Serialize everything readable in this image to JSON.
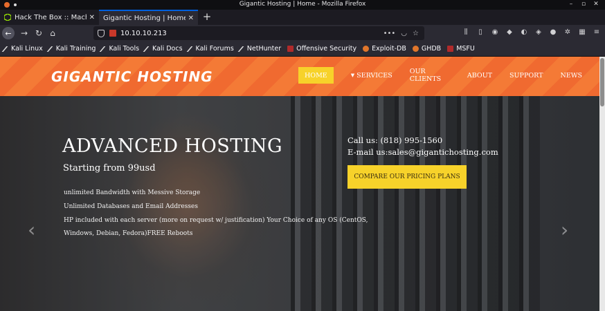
{
  "window": {
    "title": "Gigantic Hosting | Home - Mozilla Firefox"
  },
  "tabs": [
    {
      "label": "Hack The Box :: Machines",
      "active": false
    },
    {
      "label": "Gigantic Hosting | Home",
      "active": true
    }
  ],
  "nav": {
    "url": "10.10.10.213"
  },
  "bookmarks": [
    {
      "label": "Kali Linux",
      "icon": "kali-icon"
    },
    {
      "label": "Kali Training",
      "icon": "kali-icon"
    },
    {
      "label": "Kali Tools",
      "icon": "kali-icon"
    },
    {
      "label": "Kali Docs",
      "icon": "kali-icon"
    },
    {
      "label": "Kali Forums",
      "icon": "kali-icon"
    },
    {
      "label": "NetHunter",
      "icon": "kali-icon"
    },
    {
      "label": "Offensive Security",
      "icon": "offsec-icon"
    },
    {
      "label": "Exploit-DB",
      "icon": "exploitdb-icon"
    },
    {
      "label": "GHDB",
      "icon": "exploitdb-icon"
    },
    {
      "label": "MSFU",
      "icon": "offsec-icon"
    }
  ],
  "site": {
    "logo": "GIGANTIC HOSTING",
    "menu": {
      "home": "HOME",
      "services": "SERVICES",
      "clients": "OUR CLIENTS",
      "about": "ABOUT",
      "support": "SUPPORT",
      "news": "NEWS"
    },
    "hero": {
      "title": "ADVANCED HOSTING",
      "subtitle": "Starting from 99usd",
      "features": [
        "unlimited Bandwidth with Messive Storage",
        "Unlimited Databases and Email Addresses",
        "HP included with each server (more on request w/ justification) Your Choice of any OS (CentOS,",
        "Windows, Debian, Fedora)FREE Reboots"
      ],
      "phone": "Call us: (818) 995-1560",
      "email": "E-mail us:sales@gigantichosting.com",
      "cta": "COMPARE OUR PRICING PLANS"
    }
  },
  "colors": {
    "header_orange": "#f47a36",
    "accent_yellow": "#f7d22a",
    "tab_active_line": "#0060df"
  }
}
